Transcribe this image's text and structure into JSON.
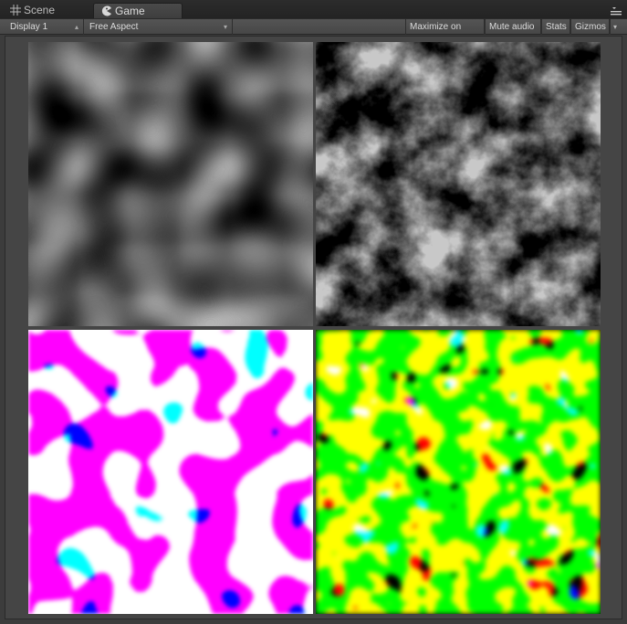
{
  "tabs": {
    "scene_label": "Scene",
    "game_label": "Game"
  },
  "toolbar": {
    "display_value": "Display 1",
    "aspect_value": "Free Aspect",
    "maximize_label": "Maximize on Play",
    "mute_label": "Mute audio",
    "stats_label": "Stats",
    "gizmos_label": "Gizmos"
  },
  "icons": {
    "scene": "grid-icon",
    "game": "pacman-icon",
    "menu": "hamburger-menu-icon"
  }
}
